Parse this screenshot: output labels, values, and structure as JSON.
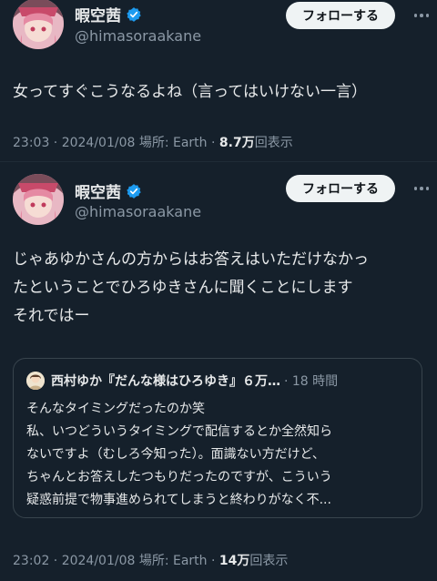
{
  "tweets": [
    {
      "display_name": "暇空茜",
      "handle": "@himasoraakane",
      "follow_label": "フォローする",
      "text_lines": [
        "女ってすぐこうなるよね（言ってはいけない一言）"
      ],
      "meta_prefix": "23:03 · 2024/01/08 場所: Earth · ",
      "views_count": "8.7万",
      "views_suffix": "回表示"
    },
    {
      "display_name": "暇空茜",
      "handle": "@himasoraakane",
      "follow_label": "フォローする",
      "text_lines": [
        "じゃあゆかさんの方からはお答えはいただけなかっ",
        "たということでひろゆきさんに聞くことにします",
        "それではー"
      ],
      "quote": {
        "author": "西村ゆか『だんな様はひろゆき』６万…",
        "time": "· 18 時間",
        "lines": [
          "そんなタイミングだったのか笑",
          "私、いつどういうタイミングで配信するとか全然知ら",
          "ないですよ（むしろ今知った）。面識ない方だけど、",
          "ちゃんとお答えしたつもりだったのですが、こういう",
          "疑惑前提で物事進められてしまうと終わりがなく不..."
        ]
      },
      "meta_prefix": "23:02 · 2024/01/08 場所: Earth · ",
      "views_count": "14万",
      "views_suffix": "回表示"
    }
  ],
  "colors": {
    "background": "#15202b",
    "text": "#e7e9ea",
    "muted": "#8b98a5",
    "verified": "#1d9bf0",
    "follow_bg": "#eff3f4"
  },
  "icons": {
    "verified": "verified-badge-icon",
    "more": "more-dots-icon"
  }
}
